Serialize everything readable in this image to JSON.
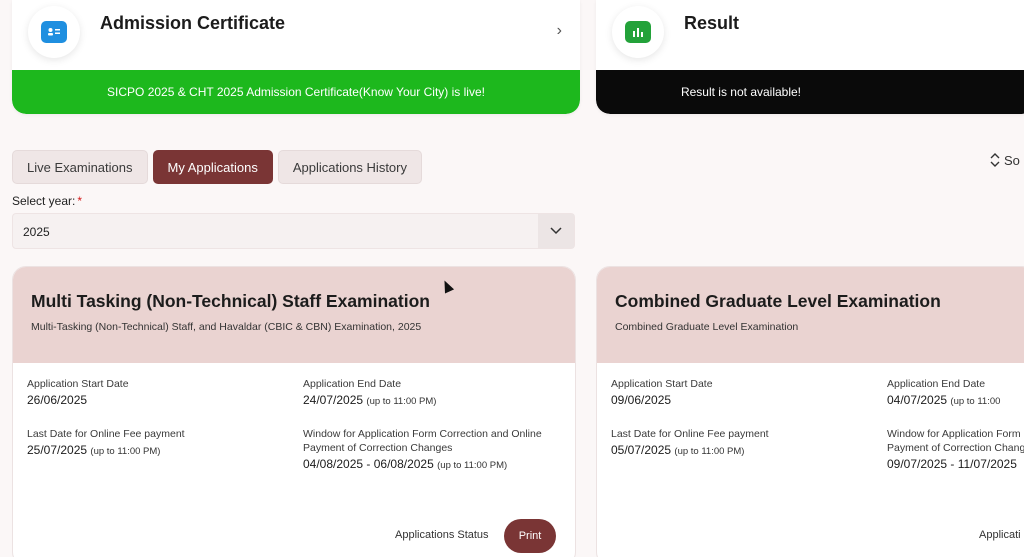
{
  "admission": {
    "title": "Admission Certificate",
    "icon": "id-card-icon",
    "icon_color": "#1f8fe0",
    "banner": "SICPO 2025 & CHT 2025 Admission Certificate(Know Your City) is live!"
  },
  "result": {
    "title": "Result",
    "icon": "bar-chart-icon",
    "icon_color": "#23a23a",
    "banner": "Result is not available!"
  },
  "tabs": [
    {
      "label": "Live Examinations",
      "active": false
    },
    {
      "label": "My Applications",
      "active": true
    },
    {
      "label": "Applications History",
      "active": false
    }
  ],
  "sort": {
    "label": "So"
  },
  "year": {
    "label": "Select year:",
    "required_mark": "*",
    "value": "2025"
  },
  "cards": [
    {
      "title": "Multi Tasking (Non-Technical) Staff Examination",
      "subtitle": "Multi-Tasking (Non-Technical) Staff, and Havaldar (CBIC & CBN) Examination, 2025",
      "start_label": "Application Start Date",
      "start_value": "26/06/2025",
      "end_label": "Application End Date",
      "end_value": "24/07/2025",
      "end_note": "(up to 11:00 PM)",
      "fee_label": "Last Date for Online Fee payment",
      "fee_value": "25/07/2025",
      "fee_note": "(up to 11:00 PM)",
      "window_label_1": "Window for Application Form Correction and Online",
      "window_label_2": "Payment of Correction Changes",
      "window_value": "04/08/2025 - 06/08/2025",
      "window_note": "(up to 11:00 PM)",
      "status_label": "Applications Status",
      "print_label": "Print"
    },
    {
      "title": "Combined Graduate Level Examination",
      "subtitle": "Combined Graduate Level Examination",
      "start_label": "Application Start Date",
      "start_value": "09/06/2025",
      "end_label": "Application End Date",
      "end_value": "04/07/2025",
      "end_note": "(up to 11:00",
      "fee_label": "Last Date for Online Fee payment",
      "fee_value": "05/07/2025",
      "fee_note": "(up to 11:00 PM)",
      "window_label_1": "Window for Application Form",
      "window_label_2": "Payment of Correction Chang",
      "window_value": "09/07/2025 - 11/07/2025",
      "status_label": "Applicati"
    }
  ]
}
